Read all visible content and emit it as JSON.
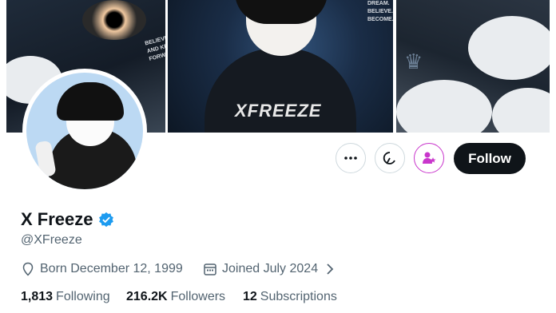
{
  "banner": {
    "center_brand": "XFREEZE",
    "left_sign": "BELIEVE IN YOURSELF, AND KEEP MOVING FORWARD.",
    "right_sign": "DREAM. BELIEVE. BECOME."
  },
  "profile": {
    "name": "X Freeze",
    "handle": "@XFreeze",
    "born": "Born December 12, 1999",
    "joined": "Joined July 2024",
    "stats": {
      "following_count": "1,813",
      "following_label": "Following",
      "followers_count": "216.2K",
      "followers_label": "Followers",
      "subscriptions_count": "12",
      "subscriptions_label": "Subscriptions"
    }
  },
  "actions": {
    "more_icon": "more-icon",
    "grok_icon": "grok-icon",
    "subscribe_icon": "subscribe-icon",
    "follow_label": "Follow"
  },
  "colors": {
    "verified": "#1d9bf0",
    "subscribe_accent": "#c936cc",
    "follow_bg": "#0f1419",
    "muted": "#536471"
  }
}
